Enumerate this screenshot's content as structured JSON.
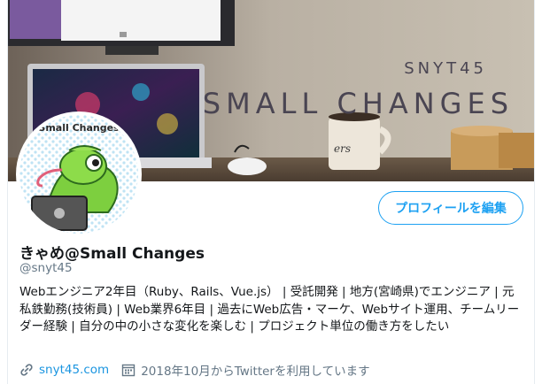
{
  "banner": {
    "brand_small": "SNYT45",
    "brand_large": "SMALL CHANGES"
  },
  "avatar": {
    "label": "Small Changes"
  },
  "profile": {
    "edit_button_label": "プロフィールを編集",
    "display_name": "きゃめ@Small Changes",
    "handle": "@snyt45",
    "bio": "Webエンジニア2年目（Ruby、Rails、Vue.js） | 受託開発 | 地方(宮崎県)でエンジニア | 元私鉄勤務(技術員) | Web業界6年目 | 過去にWeb広告・マーケ、Webサイト運用、チームリーダー経験 | 自分の中の小さな変化を楽しむ | プロジェクト単位の働き方をしたい",
    "website": "snyt45.com",
    "joined": "2018年10月からTwitterを利用しています"
  },
  "colors": {
    "accent": "#1da1f2",
    "link": "#1b95e0",
    "secondary_text": "#657786",
    "primary_text": "#14171a"
  },
  "icons": {
    "link": "link-icon",
    "calendar": "calendar-icon"
  }
}
